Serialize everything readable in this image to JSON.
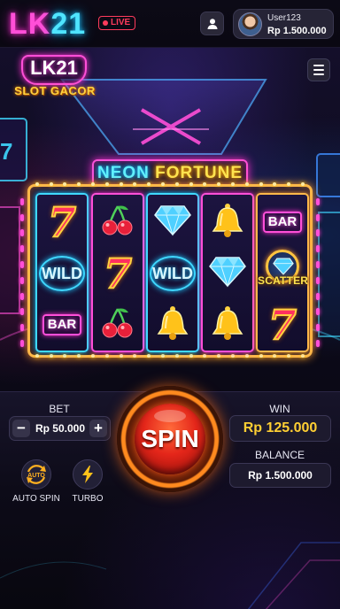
{
  "header": {
    "brand_prefix": "LK",
    "brand_number": "21",
    "live_badge": "LIVE",
    "user": {
      "name": "User123",
      "balance": "Rp 1.500.000"
    }
  },
  "game": {
    "logo_main": "LK21",
    "logo_sub": "SLOT GACOR",
    "title_part1": "NEON",
    "title_part2": "FORTUNE",
    "reels": [
      [
        "seven",
        "wild",
        "bar"
      ],
      [
        "cherry",
        "seven",
        "cherry"
      ],
      [
        "diamond",
        "wild",
        "bell"
      ],
      [
        "bell",
        "diamond",
        "bell"
      ],
      [
        "bar",
        "scatter",
        "seven"
      ]
    ],
    "symbol_text": {
      "seven": "7",
      "bar": "BAR",
      "wild": "WILD",
      "scatter": "SCATTER"
    },
    "colors": {
      "neon_pink": "#ff4fd8",
      "neon_cyan": "#3fd8ff",
      "gold": "#ffcf33",
      "spin_red": "#e4261a"
    }
  },
  "controls": {
    "bet_label": "BET",
    "bet_value": "Rp 50.000",
    "minus": "−",
    "plus": "+",
    "spin_label": "SPIN",
    "win_label": "WIN",
    "win_value": "Rp 125.000",
    "balance_label": "BALANCE",
    "balance_value": "Rp 1.500.000",
    "auto_spin_label": "AUTO SPIN",
    "auto_icon_text": "AUTO",
    "turbo_label": "TURBO"
  }
}
